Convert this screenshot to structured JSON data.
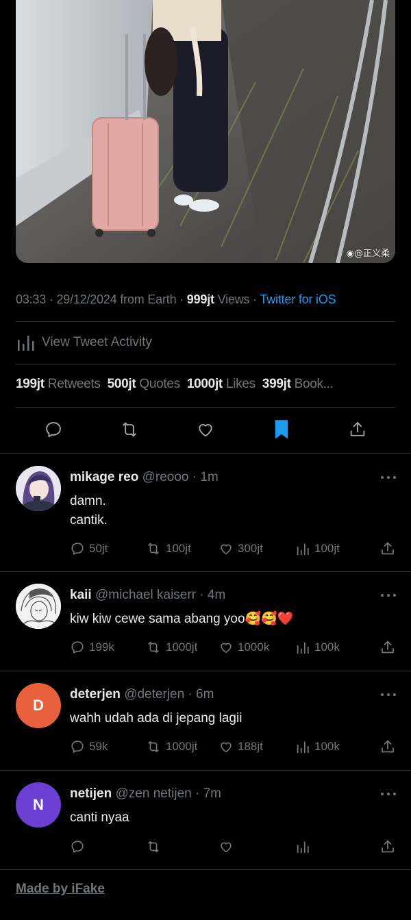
{
  "photo": {
    "watermark": "@正义柔"
  },
  "meta": {
    "time": "03:33",
    "date": "29/12/2024",
    "from": "from Earth",
    "views_count": "999jt",
    "views_label": "Views",
    "client": "Twitter for iOS"
  },
  "activity": {
    "label": "View Tweet Activity"
  },
  "stats": [
    {
      "count": "199jt",
      "label": "Retweets"
    },
    {
      "count": "500jt",
      "label": "Quotes"
    },
    {
      "count": "1000jt",
      "label": "Likes"
    },
    {
      "count": "399jt",
      "label": "Book..."
    }
  ],
  "colors": {
    "accent": "#1d9bf0",
    "muted": "#71767b",
    "divider": "#2f3336"
  },
  "replies": [
    {
      "name": "mikage reo",
      "handle": "@reooo",
      "time": "1m",
      "text": "damn.\ncantik.",
      "reply_count": "50jt",
      "retweet_count": "100jt",
      "like_count": "300jt",
      "view_count": "100jt",
      "avatar": {
        "type": "image",
        "initial": ""
      }
    },
    {
      "name": "kaii",
      "handle": "@michael kaiserr",
      "time": "4m",
      "text": "kiw kiw cewe sama abang yoo🥰🥰❤️",
      "reply_count": "199k",
      "retweet_count": "1000jt",
      "like_count": "1000k",
      "view_count": "100k",
      "avatar": {
        "type": "image",
        "initial": ""
      }
    },
    {
      "name": "deterjen",
      "handle": "@deterjen",
      "time": "6m",
      "text": "wahh udah ada di jepang lagii",
      "reply_count": "59k",
      "retweet_count": "1000jt",
      "like_count": "188jt",
      "view_count": "100k",
      "avatar": {
        "type": "initial",
        "initial": "D",
        "color": "#e8603c"
      }
    },
    {
      "name": "netijen",
      "handle": "@zen netijen",
      "time": "7m",
      "text": "canti nyaa",
      "reply_count": "",
      "retweet_count": "",
      "like_count": "",
      "view_count": "",
      "avatar": {
        "type": "initial",
        "initial": "N",
        "color": "#6b3fd1"
      }
    }
  ],
  "footer": {
    "label": "Made by iFake"
  }
}
